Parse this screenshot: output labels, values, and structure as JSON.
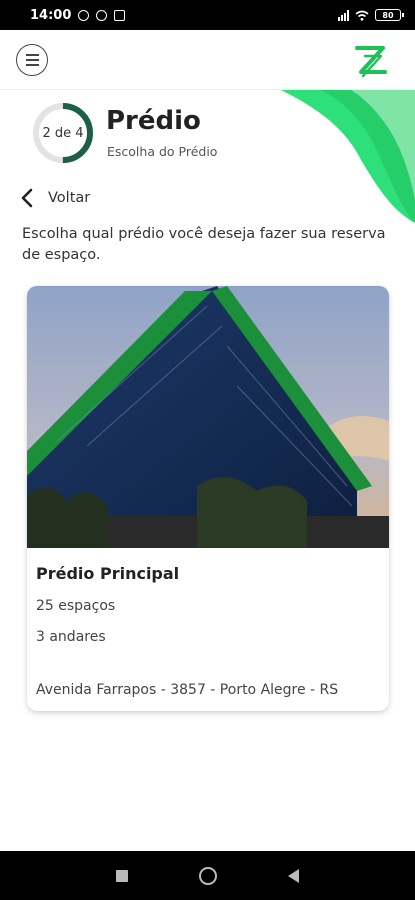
{
  "status_bar": {
    "time": "14:00",
    "battery": "80"
  },
  "step": {
    "indicator": "2 de 4",
    "progress": 0.5,
    "title": "Prédio",
    "subtitle": "Escolha do Prédio"
  },
  "back": {
    "label": "Voltar"
  },
  "instruction": "Escolha qual prédio você deseja fazer sua reserva de espaço.",
  "buildings": [
    {
      "name": "Prédio Principal",
      "spaces": "25 espaços",
      "floors": "3 andares",
      "address": "Avenida Farrapos - 3857 - Porto Alegre - RS"
    }
  ],
  "colors": {
    "brand_green": "#1fbf5a",
    "accent_green": "#2ee07a",
    "ring_grey": "#e3e3e3",
    "ring_dark": "#1f5f45"
  },
  "icons": {
    "menu": "hamburger-menu-icon",
    "logo": "z-logo-icon",
    "back": "chevron-left-icon"
  }
}
